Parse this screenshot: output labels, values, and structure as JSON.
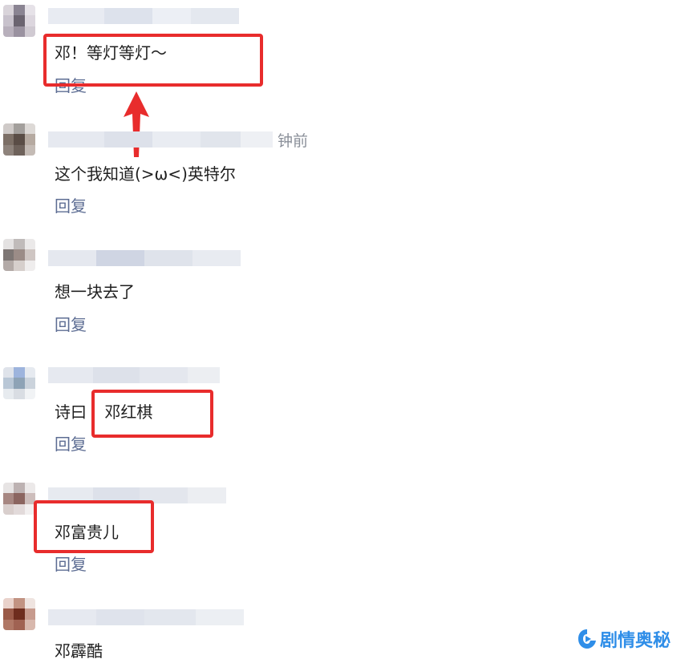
{
  "comments": [
    {
      "username_partial": "",
      "time": "",
      "text": "邓！等灯等灯～",
      "reply_label": "回复"
    },
    {
      "username_partial": "",
      "time": "钟前",
      "text": "这个我知道(>ω<)英特尔",
      "reply_label": "回复"
    },
    {
      "username_partial": "",
      "time": "",
      "text": "想一块去了",
      "reply_label": "回复"
    },
    {
      "username_partial": "",
      "time": "",
      "text_prefix": "诗曰",
      "text_highlight": "邓红棋",
      "reply_label": "回复"
    },
    {
      "username_partial": "",
      "time": "",
      "text": "邓富贵儿",
      "reply_label": "回复"
    },
    {
      "username_partial": "",
      "time": "",
      "text": "邓霹酷",
      "reply_label": ""
    }
  ],
  "watermark": {
    "text": "剧情奥秘",
    "icon": "play-logo-icon"
  },
  "colors": {
    "highlight": "#e82c2c",
    "reply_link": "#5d6d93",
    "arrow": "#e82c2c",
    "watermark": "#2f8ee8"
  }
}
